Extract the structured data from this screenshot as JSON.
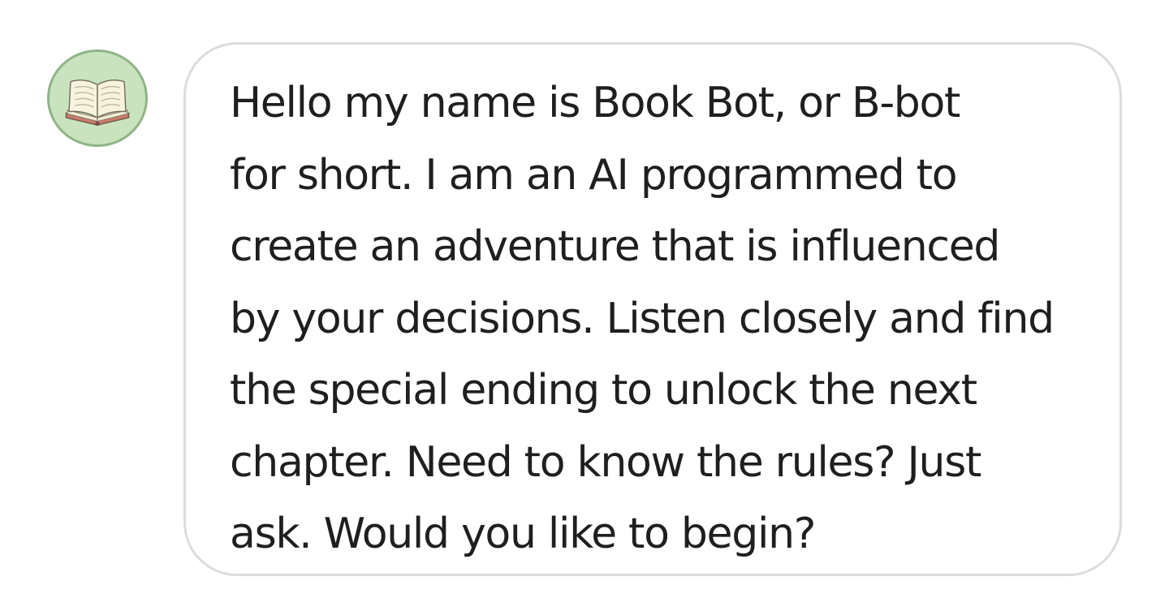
{
  "avatar": {
    "icon": "open-book-icon",
    "background_color": "#c9e3bf",
    "ring_color": "#8fb487"
  },
  "message": {
    "lines": [
      "Hello my name is Book Bot, or B-bot",
      "for short. I am an AI programmed to",
      "create an adventure that is influenced",
      "by your decisions. Listen closely and find",
      "the special ending to unlock the next",
      "chapter. Need to know the rules? Just",
      "ask. Would you like to begin?"
    ],
    "text_color": "#1f1f1f",
    "border_color": "#dadce0"
  }
}
